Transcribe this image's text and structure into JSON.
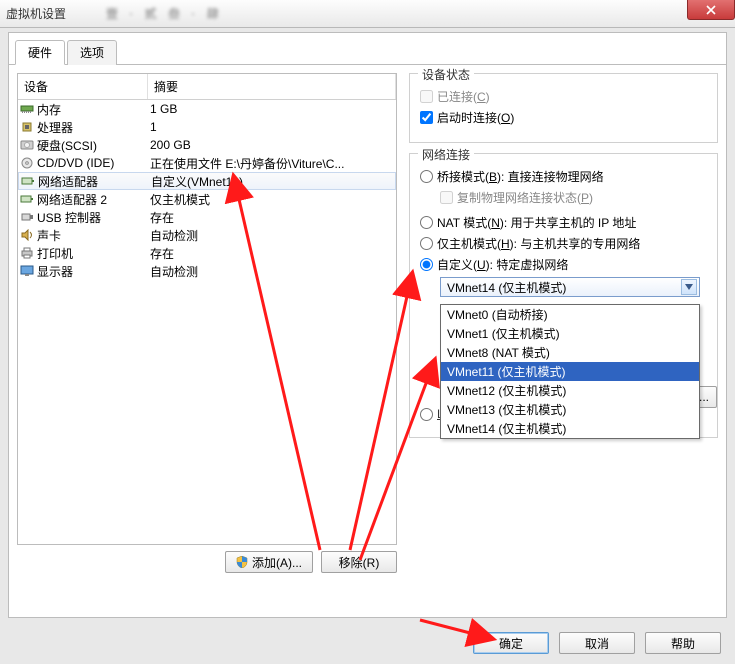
{
  "window": {
    "title": "虚拟机设置"
  },
  "tabs": {
    "hardware": "硬件",
    "options": "选项"
  },
  "list": {
    "header": {
      "device": "设备",
      "summary": "摘要"
    },
    "rows": [
      {
        "icon": "memory-icon",
        "device": "内存",
        "summary": "1 GB",
        "selected": false
      },
      {
        "icon": "cpu-icon",
        "device": "处理器",
        "summary": "1",
        "selected": false
      },
      {
        "icon": "disk-icon",
        "device": "硬盘(SCSI)",
        "summary": "200 GB",
        "selected": false
      },
      {
        "icon": "cd-icon",
        "device": "CD/DVD (IDE)",
        "summary": "正在使用文件 E:\\丹婷备份\\Viture\\C...",
        "selected": false
      },
      {
        "icon": "net-icon",
        "device": "网络适配器",
        "summary": "自定义(VMnet14)",
        "selected": true
      },
      {
        "icon": "net-icon",
        "device": "网络适配器 2",
        "summary": "仅主机模式",
        "selected": false
      },
      {
        "icon": "usb-icon",
        "device": "USB 控制器",
        "summary": "存在",
        "selected": false
      },
      {
        "icon": "sound-icon",
        "device": "声卡",
        "summary": "自动检测",
        "selected": false
      },
      {
        "icon": "printer-icon",
        "device": "打印机",
        "summary": "存在",
        "selected": false
      },
      {
        "icon": "display-icon",
        "device": "显示器",
        "summary": "自动检测",
        "selected": false
      }
    ]
  },
  "left_buttons": {
    "add": "添加(A)...",
    "remove": "移除(R)"
  },
  "device_status": {
    "legend": "设备状态",
    "connected": {
      "label_pre": "已连接(",
      "hot": "C",
      "label_post": ")",
      "checked": false,
      "enabled": false
    },
    "connect_on": {
      "label_pre": "启动时连接(",
      "hot": "O",
      "label_post": ")",
      "checked": true
    }
  },
  "net_conn": {
    "legend": "网络连接",
    "bridge": {
      "label_pre": "桥接模式(",
      "hot": "B",
      "label_post": "): 直接连接物理网络",
      "checked": false
    },
    "replicate": {
      "label_pre": "复制物理网络连接状态(",
      "hot": "P",
      "label_post": ")",
      "checked": false,
      "enabled": false
    },
    "nat": {
      "label_pre": "NAT 模式(",
      "hot": "N",
      "label_post": "): 用于共享主机的 IP 地址",
      "checked": false
    },
    "hostonly": {
      "label_pre": "仅主机模式(",
      "hot": "H",
      "label_post": "): 与主机共享的专用网络",
      "checked": false
    },
    "custom": {
      "label_pre": "自定义(",
      "hot": "U",
      "label_post": "): 特定虚拟网络",
      "checked": true
    },
    "combo_selected": "VMnet14 (仅主机模式)",
    "options": [
      {
        "label": "VMnet0 (自动桥接)",
        "hi": false
      },
      {
        "label": "VMnet1 (仅主机模式)",
        "hi": false
      },
      {
        "label": "VMnet8 (NAT 模式)",
        "hi": false
      },
      {
        "label": "VMnet11 (仅主机模式)",
        "hi": true
      },
      {
        "label": "VMnet12 (仅主机模式)",
        "hi": false
      },
      {
        "label": "VMnet13 (仅主机模式)",
        "hi": false
      },
      {
        "label": "VMnet14 (仅主机模式)",
        "hi": false
      }
    ],
    "lan_peek": {
      "label_pre": "L",
      "label_post": ")..."
    }
  },
  "bottom": {
    "ok": "确定",
    "cancel": "取消",
    "help": "帮助"
  }
}
